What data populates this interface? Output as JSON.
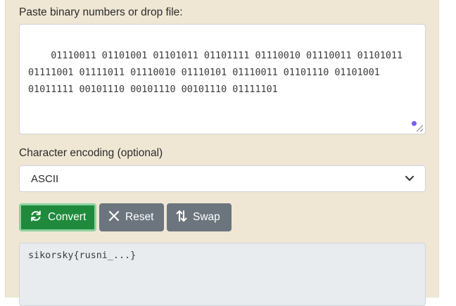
{
  "input": {
    "label": "Paste binary numbers or drop file:",
    "value": "01110011 01101001 01101011 01101111 01110010 01110011 01101011 01111001 01111011 01110010 01110101 01110011 01101110 01101001 01011111 00101110 00101110 00101110 01111101"
  },
  "encoding": {
    "label": "Character encoding (optional)",
    "selected": "ASCII"
  },
  "buttons": {
    "convert": "Convert",
    "reset": "Reset",
    "swap": "Swap"
  },
  "output": {
    "value": "sikorsky{rusni_...}"
  },
  "colors": {
    "panel_bg": "#efe7d4",
    "convert_bg": "#1f8a3b",
    "secondary_bg": "#6c757d",
    "output_bg": "#e9ecef",
    "accent_dot": "#7b5cf0"
  }
}
